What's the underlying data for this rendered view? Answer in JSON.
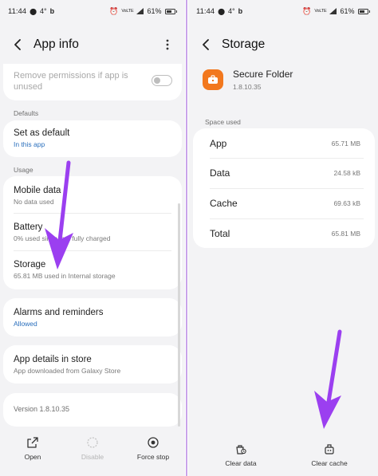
{
  "status_bar": {
    "time": "11:44",
    "weather": "4°",
    "carrier_glyph": "b",
    "network": "VoLTE",
    "battery": "61%"
  },
  "left_screen": {
    "title": "App info",
    "items": {
      "remove_permissions": {
        "label": "Remove permissions if app is unused",
        "toggle_on": false
      },
      "defaults_section": "Defaults",
      "set_as_default": {
        "label": "Set as default",
        "sub": "In this app"
      },
      "usage_section": "Usage",
      "mobile_data": {
        "label": "Mobile data",
        "sub": "No data used"
      },
      "battery": {
        "label": "Battery",
        "sub": "0% used since last fully charged"
      },
      "storage": {
        "label": "Storage",
        "sub": "65.81 MB used in Internal storage"
      },
      "alarms": {
        "label": "Alarms and reminders",
        "sub": "Allowed"
      },
      "store": {
        "label": "App details in store",
        "sub": "App downloaded from Galaxy Store"
      },
      "version": "Version 1.8.10.35"
    },
    "bottom_bar": {
      "open": "Open",
      "disable": "Disable",
      "force_stop": "Force stop"
    }
  },
  "right_screen": {
    "title": "Storage",
    "app_name": "Secure Folder",
    "app_version": "1.8.10.35",
    "section": "Space used",
    "rows": [
      {
        "label": "App",
        "value": "65.71 MB"
      },
      {
        "label": "Data",
        "value": "24.58 kB"
      },
      {
        "label": "Cache",
        "value": "69.63 kB"
      },
      {
        "label": "Total",
        "value": "65.81 MB"
      }
    ],
    "bottom_bar": {
      "clear_data": "Clear data",
      "clear_cache": "Clear cache"
    }
  },
  "colors": {
    "annotation_arrow": "#9b3ff0",
    "app_icon": "#f2781e",
    "link_blue": "#2a6fbd"
  }
}
